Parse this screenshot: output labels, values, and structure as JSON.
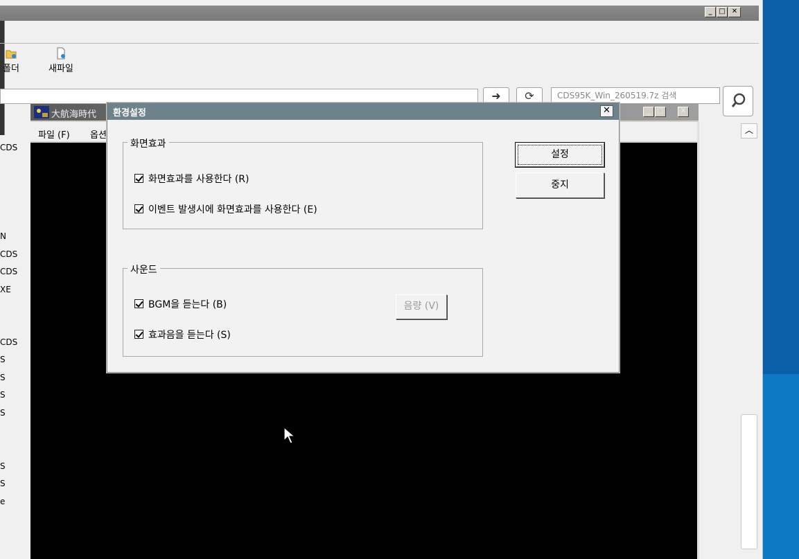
{
  "explorer": {
    "toolbar": {
      "new_folder_label": "폴더",
      "new_file_label": "새파일"
    },
    "search": {
      "placeholder": "CDS95K_Win_260519.7z 검색"
    },
    "files": [
      "CDS",
      "N",
      "CDS",
      "CDS",
      "XE",
      "CDS",
      "S",
      "S",
      "S",
      "S",
      "S",
      "S",
      "e"
    ]
  },
  "game": {
    "title": "大航海時代",
    "menu": [
      "파일 (F)",
      "옵션"
    ]
  },
  "dialog": {
    "title": "환경설정",
    "close_glyph": "✕",
    "visual_group": {
      "label": "화면효과",
      "options": [
        {
          "label": "화면효과를 사용한다 (R)",
          "checked": true
        },
        {
          "label": "이벤트 발생시에 화면효과를 사용한다 (E)",
          "checked": true
        }
      ]
    },
    "sound_group": {
      "label": "사운드",
      "options": [
        {
          "label": "BGM을 듣는다 (B)",
          "checked": true
        },
        {
          "label": "효과음을 듣는다 (S)",
          "checked": true
        }
      ],
      "volume_label": "음량 (V)"
    },
    "ok_label": "설정",
    "cancel_label": "중지"
  }
}
